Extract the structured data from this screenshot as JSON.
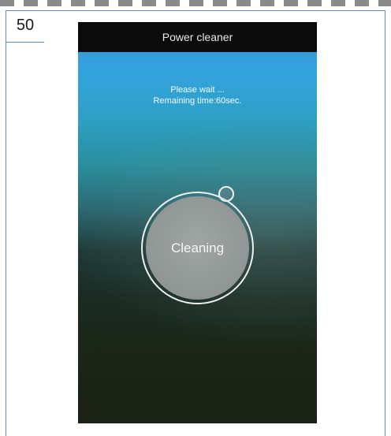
{
  "document": {
    "page_number": "50"
  },
  "app": {
    "title": "Power cleaner",
    "status_line1": "Please wait ...",
    "status_line2": "Remaining time:60sec.",
    "action_label": "Cleaning"
  }
}
